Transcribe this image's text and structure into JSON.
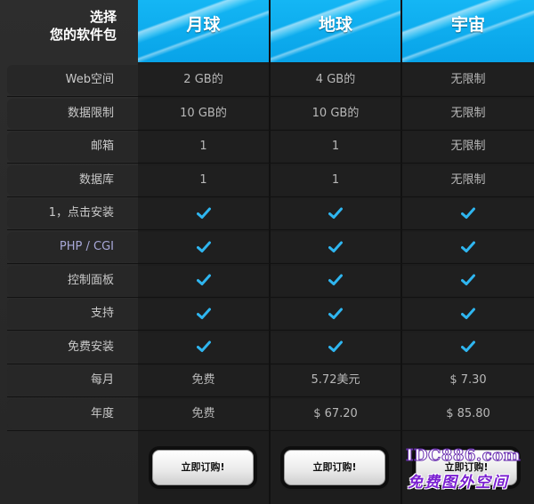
{
  "header": {
    "corner_line1": "选择",
    "corner_line2": "您的软件包",
    "plans": [
      "月球",
      "地球",
      "宇宙"
    ]
  },
  "rows": [
    {
      "label": "Web空间",
      "values": [
        "2 GB的",
        "4 GB的",
        "无限制"
      ]
    },
    {
      "label": "数据限制",
      "values": [
        "10 GB的",
        "10 GB的",
        "无限制"
      ]
    },
    {
      "label": "邮箱",
      "values": [
        "1",
        "1",
        "无限制"
      ]
    },
    {
      "label": "数据库",
      "values": [
        "1",
        "1",
        "无限制"
      ]
    },
    {
      "label": "1，点击安装",
      "values": [
        "check",
        "check",
        "check"
      ]
    },
    {
      "label": "PHP / CGI",
      "values": [
        "check",
        "check",
        "check"
      ]
    },
    {
      "label": "控制面板",
      "values": [
        "check",
        "check",
        "check"
      ]
    },
    {
      "label": "支持",
      "values": [
        "check",
        "check",
        "check"
      ]
    },
    {
      "label": "免费安装",
      "values": [
        "check",
        "check",
        "check"
      ]
    },
    {
      "label": "每月",
      "values": [
        "免费",
        "5.72美元",
        "$ 7.30"
      ]
    },
    {
      "label": "年度",
      "values": [
        "免费",
        "$ 67.20",
        "$ 85.80"
      ]
    }
  ],
  "buttons": {
    "order_label": "立即订购!"
  },
  "watermark": {
    "line1": "IDC886.com",
    "line2": "免费图外空间"
  },
  "colors": {
    "header_blue": "#0ea8ee",
    "check_blue": "#2fb6f0",
    "background": "#1d1d1d"
  }
}
